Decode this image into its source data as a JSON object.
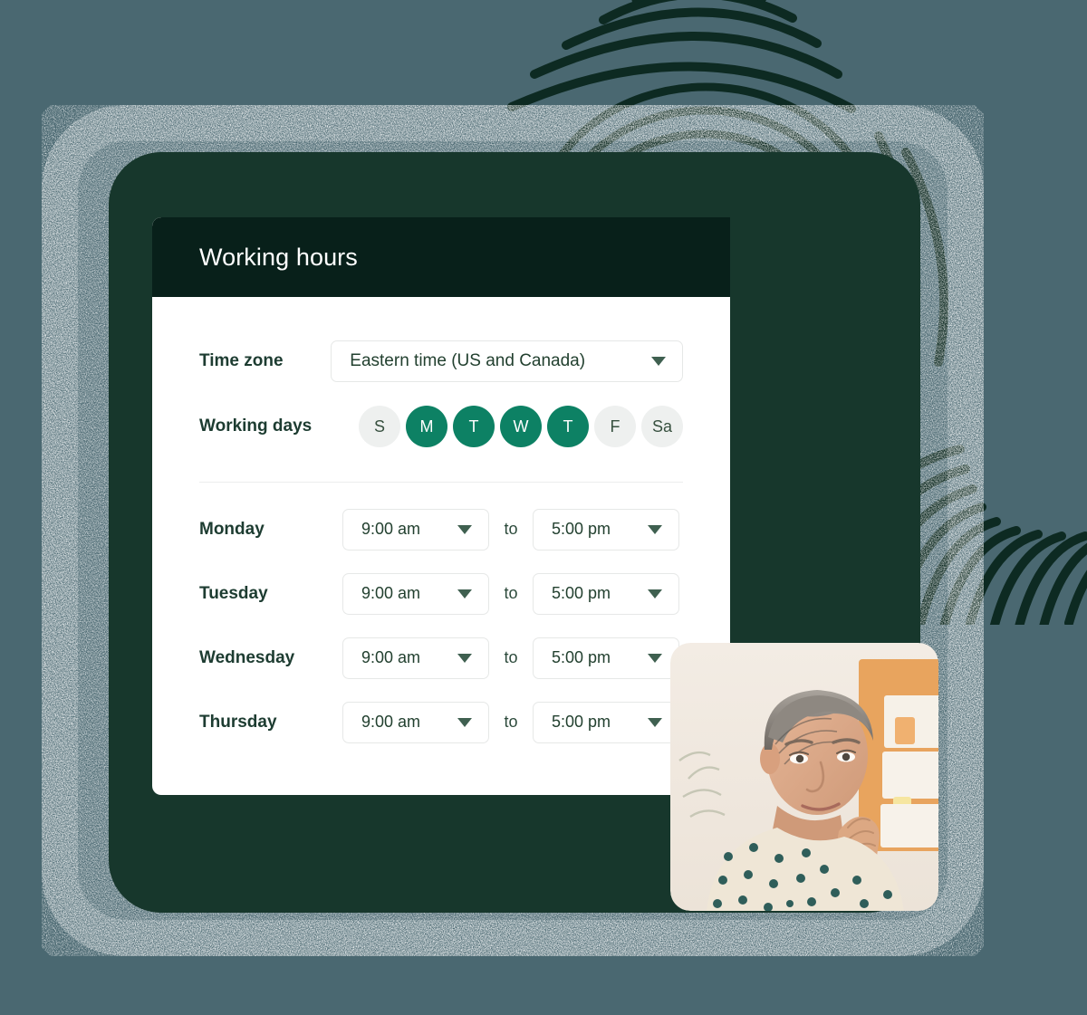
{
  "card": {
    "title": "Working hours"
  },
  "timezone": {
    "label": "Time zone",
    "value": "Eastern time (US and Canada)",
    "caret_icon": "chevron-down-icon"
  },
  "working_days": {
    "label": "Working days",
    "days": [
      {
        "letter": "S",
        "name": "Sunday",
        "active": false
      },
      {
        "letter": "M",
        "name": "Monday",
        "active": true
      },
      {
        "letter": "T",
        "name": "Tuesday",
        "active": true
      },
      {
        "letter": "W",
        "name": "Wednesday",
        "active": true
      },
      {
        "letter": "T",
        "name": "Thursday",
        "active": true
      },
      {
        "letter": "F",
        "name": "Friday",
        "active": false
      },
      {
        "letter": "Sa",
        "name": "Saturday",
        "active": false
      }
    ]
  },
  "schedule": {
    "separator_label": "to",
    "rows": [
      {
        "day": "Monday",
        "start": "9:00 am",
        "end": "5:00 pm"
      },
      {
        "day": "Tuesday",
        "start": "9:00 am",
        "end": "5:00 pm"
      },
      {
        "day": "Wednesday",
        "start": "9:00 am",
        "end": "5:00 pm"
      },
      {
        "day": "Thursday",
        "start": "9:00 am",
        "end": "5:00 pm"
      }
    ]
  },
  "decor": {
    "fingerprint_icon": "fingerprint-graphic",
    "photo_alt": "portrait-photo-woman-hand-on-chin"
  },
  "colors": {
    "page_background": "#4a6871",
    "frame_green": "#17372c",
    "header_green": "#08201a",
    "accent_green": "#0d8164",
    "label_text": "#1d3c31",
    "fingerprint_ink": "#0d2a22",
    "card_white": "#ffffff",
    "toggle_off": "#eef0ef",
    "divider": "#eceeed"
  }
}
